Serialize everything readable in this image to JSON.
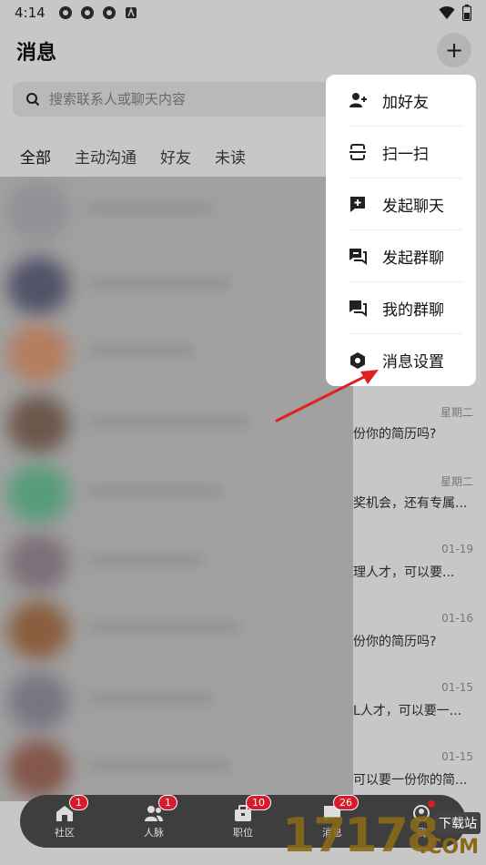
{
  "status_bar": {
    "time": "4:14"
  },
  "header": {
    "title": "消息",
    "plus_label": "+"
  },
  "search": {
    "placeholder": "搜索联系人或聊天内容"
  },
  "tabs": [
    {
      "label": "全部"
    },
    {
      "label": "主动沟通"
    },
    {
      "label": "好友"
    },
    {
      "label": "未读"
    }
  ],
  "messages": [
    {
      "date": "星期二",
      "preview": "份你的简历吗?"
    },
    {
      "date": "星期二",
      "preview": "奖机会，还有专属..."
    },
    {
      "date": "01-19",
      "preview": "理人才，可以要..."
    },
    {
      "date": "01-16",
      "preview": "份你的简历吗?"
    },
    {
      "date": "01-15",
      "preview": "L人才，可以要一..."
    },
    {
      "date": "01-15",
      "preview": "可以要一份你的简..."
    }
  ],
  "menu": {
    "items": [
      {
        "label": "加好友",
        "icon": "add-friend-icon"
      },
      {
        "label": "扫一扫",
        "icon": "scan-icon"
      },
      {
        "label": "发起聊天",
        "icon": "new-chat-icon"
      },
      {
        "label": "发起群聊",
        "icon": "group-chat-icon"
      },
      {
        "label": "我的群聊",
        "icon": "my-groups-icon"
      },
      {
        "label": "消息设置",
        "icon": "settings-icon"
      }
    ]
  },
  "bottom_nav": {
    "items": [
      {
        "label": "社区",
        "badge": "1"
      },
      {
        "label": "人脉",
        "badge": "1"
      },
      {
        "label": "职位",
        "badge": "10"
      },
      {
        "label": "消息",
        "badge": "26"
      },
      {
        "label": "我",
        "badge": ""
      }
    ]
  },
  "watermark": {
    "digits": "17178",
    "tag": "下载站",
    "com": ".COM"
  },
  "colors": {
    "accent_red": "#d81b2a",
    "arrow_red": "#e02020",
    "nav_bg": "#3e3e3e"
  }
}
